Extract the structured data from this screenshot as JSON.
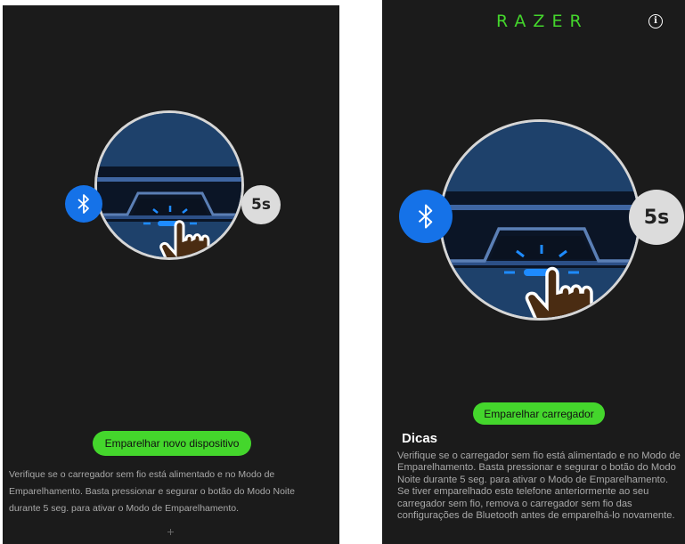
{
  "left": {
    "pair_button_label": "Emparelhar novo dispositivo",
    "seconds_badge": "5s",
    "instructions": "Verifique se o carregador sem fio está alimentado e no Modo de Emparelhamento. Basta pressionar e segurar o botão do Modo Noite durante 5 seg. para ativar o Modo de Emparelhamento."
  },
  "right": {
    "brand_logo": "RAZER",
    "info_icon": "info-icon",
    "seconds_badge": "5s",
    "pair_button_label": "Emparelhar carregador",
    "tips_heading": "Dicas",
    "tips_text": "Verifique se o carregador sem fio está alimentado e no Modo de Emparelhamento. Basta pressionar e segurar o botão do Modo Noite durante 5 seg. para ativar o Modo de Emparelhamento. Se tiver emparelhado este telefone anteriormente ao seu carregador sem fio, remova o carregador sem fio das configurações de Bluetooth antes de emparelhá-lo novamente."
  },
  "colors": {
    "accent": "#44d62c",
    "background": "#1b1b1b",
    "bluetooth": "#1572e8",
    "led": "#1e8bff"
  }
}
